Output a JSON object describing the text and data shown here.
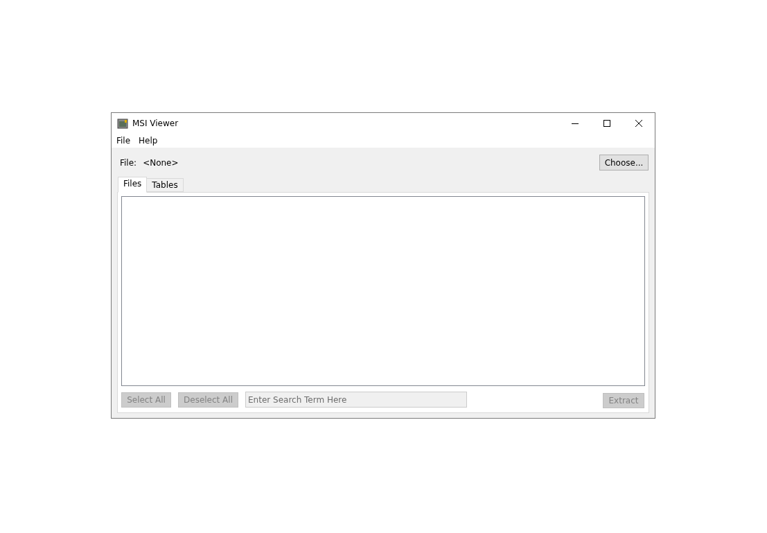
{
  "window": {
    "title": "MSI Viewer"
  },
  "menu": [
    "File",
    "Help"
  ],
  "file_row": {
    "label": "File:",
    "value": "<None>",
    "button": "Choose..."
  },
  "tabs": [
    {
      "label": "Files",
      "selected": true
    },
    {
      "label": "Tables",
      "selected": false
    }
  ],
  "actions": {
    "select_all": {
      "label": "Select All",
      "disabled": true
    },
    "deselect_all": {
      "label": "Deselect All",
      "disabled": true
    },
    "search": {
      "placeholder": "Enter Search Term Here",
      "disabled": true
    },
    "extract": {
      "label": "Extract",
      "disabled": true
    }
  }
}
